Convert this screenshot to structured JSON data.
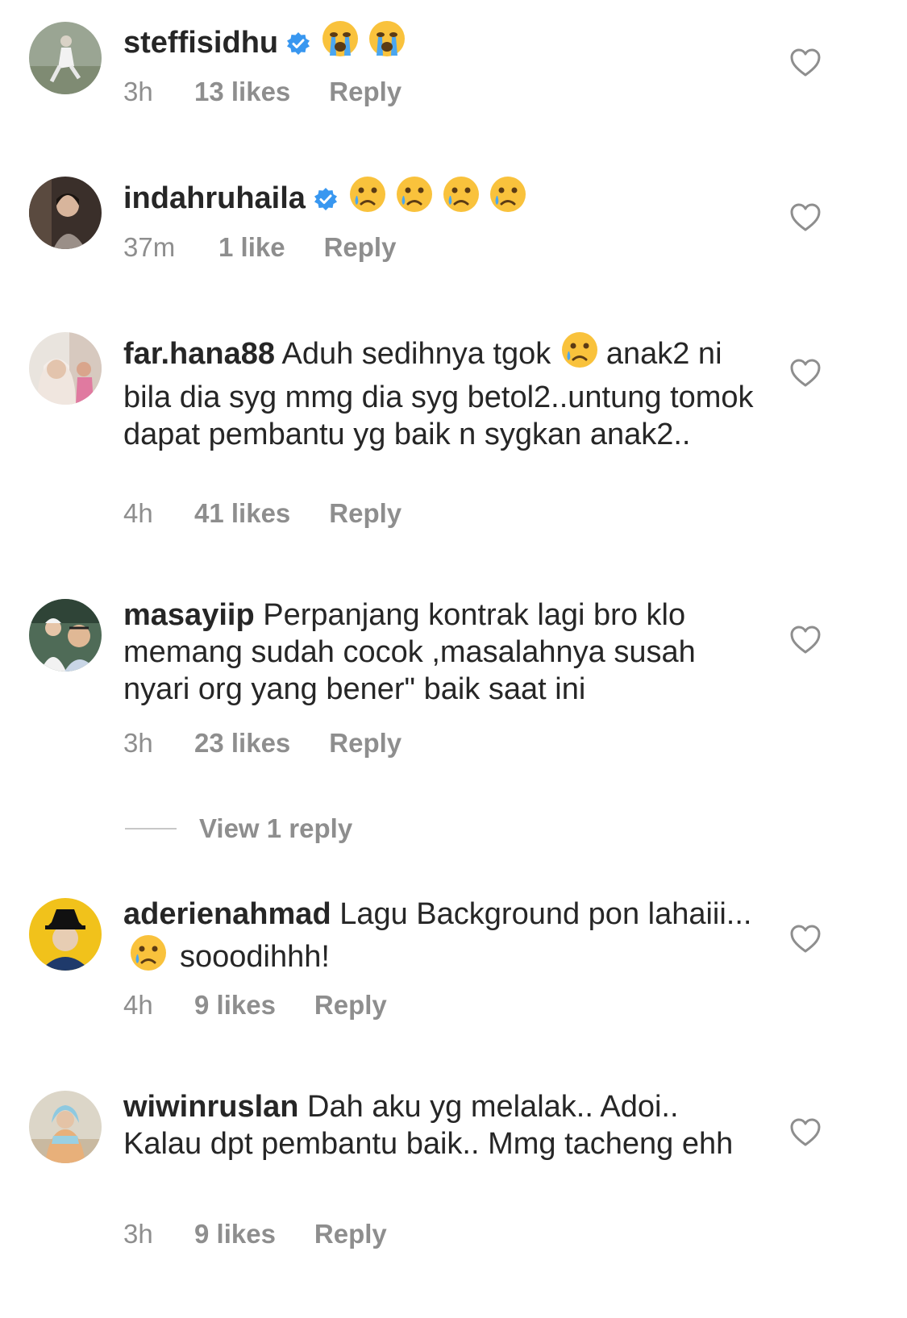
{
  "comments": [
    {
      "username": "steffisidhu",
      "verified": true,
      "text": "",
      "emojis": [
        "loudly-crying-face-emoji",
        "loudly-crying-face-emoji"
      ],
      "time": "3h",
      "likes": "13 likes",
      "reply": "Reply"
    },
    {
      "username": "indahruhaila",
      "verified": true,
      "text": "",
      "emojis": [
        "crying-face-emoji",
        "crying-face-emoji",
        "crying-face-emoji",
        "crying-face-emoji"
      ],
      "time": "37m",
      "likes": "1 like",
      "reply": "Reply"
    },
    {
      "username": "far.hana88",
      "verified": false,
      "text_before_emoji": "Aduh sedihnya tgok",
      "emojis": [
        "crying-face-emoji"
      ],
      "text_after_emoji": "anak2 ni bila dia syg mmg dia syg betol2..untung tomok dapat pembantu yg baik n sygkan anak2..",
      "time": "4h",
      "likes": "41 likes",
      "reply": "Reply"
    },
    {
      "username": "masayiip",
      "verified": false,
      "text": "Perpanjang kontrak lagi bro klo memang sudah cocok ,masalahnya susah nyari org yang bener\" baik saat ini",
      "time": "3h",
      "likes": "23 likes",
      "reply": "Reply"
    },
    {
      "username": "aderienahmad",
      "verified": false,
      "text_before_emoji": "Lagu Background pon lahaiii...",
      "emojis": [
        "crying-face-emoji"
      ],
      "text_after_emoji": "sooodihhh!",
      "time": "4h",
      "likes": "9 likes",
      "reply": "Reply"
    },
    {
      "username": "wiwinruslan",
      "verified": false,
      "text": "Dah aku yg melalak.. Adoi.. Kalau dpt pembantu baik.. Mmg tacheng ehh",
      "time": "3h",
      "likes": "9 likes",
      "reply": "Reply"
    }
  ],
  "view_replies": "View 1 reply",
  "colors": {
    "text": "#262626",
    "meta": "#8e8e8e",
    "verified_blue": "#3897f0",
    "heart_stroke": "#8e8e8e"
  }
}
